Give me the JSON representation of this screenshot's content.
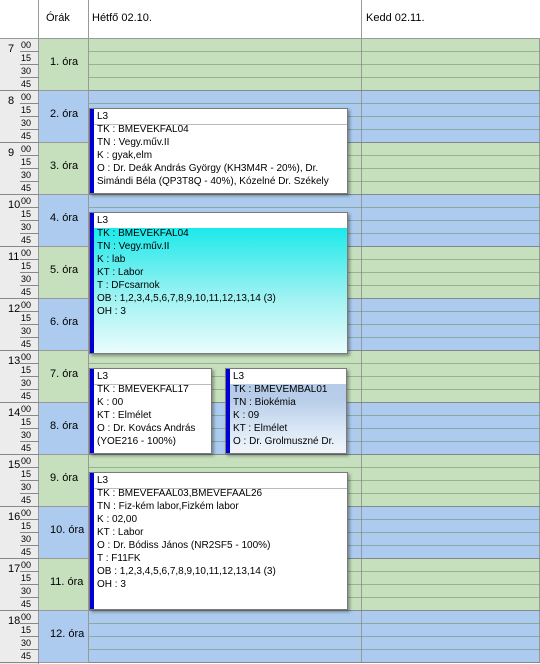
{
  "header": {
    "hours_label": "Órák",
    "day1": "Hétfő  02.10.",
    "day2": "Kedd  02.11."
  },
  "hours": [
    "7",
    "8",
    "9",
    "10",
    "11",
    "12",
    "13",
    "14",
    "15",
    "16",
    "17",
    "18"
  ],
  "minutes": [
    "00",
    "15",
    "30",
    "45"
  ],
  "lessons": [
    "1. óra",
    "2. óra",
    "3. óra",
    "4. óra",
    "5. óra",
    "6. óra",
    "7. óra",
    "8. óra",
    "9. óra",
    "10. óra",
    "11. óra",
    "12. óra"
  ],
  "events": [
    {
      "title": "L3",
      "lines": [
        "TK : BMEVEKFAL04",
        "TN : Vegy.műv.II",
        "K : gyak,elm",
        "O :  Dr. Deák András György (KH3M4R - 20%), Dr.",
        "Simándi Béla (QP3T8Q - 40%), Kózelné Dr. Székely"
      ]
    },
    {
      "title": "L3",
      "lines": [
        "TK : BMEVEKFAL04",
        "TN : Vegy.műv.II",
        "K : lab",
        "KT : Labor",
        "T : DFcsarnok",
        "OB : 1,2,3,4,5,6,7,8,9,10,11,12,13,14 (3)",
        "OH : 3"
      ]
    },
    {
      "title": "L3",
      "lines": [
        "TK : BMEVEKFAL17",
        "K : 00",
        "KT : Elmélet",
        "O :  Dr. Kovács András",
        "(YOE216 - 100%)"
      ]
    },
    {
      "title": "L3",
      "lines": [
        "TK : BMEVEMBAL01",
        "TN : Biokémia",
        "K : 09",
        "KT : Elmélet",
        "O :  Dr. Grolmuszné Dr."
      ]
    },
    {
      "title": "L3",
      "lines": [
        "TK : BMEVEFAAL03,BMEVEFAAL26",
        "TN : Fiz-kém labor,Fizkém labor",
        "K : 02,00",
        "KT : Labor",
        "O :  Dr. Bódiss János (NR2SF5 - 100%)",
        "T : F11FK",
        "OB : 1,2,3,4,5,6,7,8,9,10,11,12,13,14 (3)",
        "OH : 3"
      ]
    }
  ]
}
